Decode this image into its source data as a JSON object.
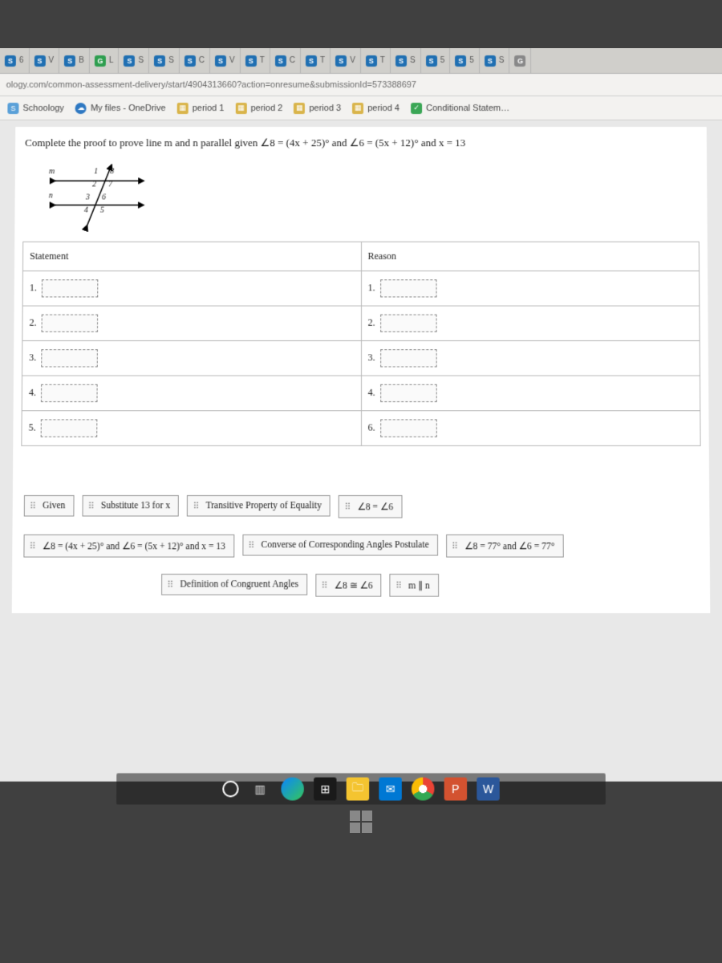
{
  "browser": {
    "tabs": [
      {
        "icon": "S",
        "label": "6"
      },
      {
        "icon": "S",
        "label": "V"
      },
      {
        "icon": "S",
        "label": "B"
      },
      {
        "icon": "G",
        "label": "L"
      },
      {
        "icon": "S",
        "label": "S"
      },
      {
        "icon": "S",
        "label": "S"
      },
      {
        "icon": "S",
        "label": "C"
      },
      {
        "icon": "S",
        "label": "V"
      },
      {
        "icon": "S",
        "label": "T"
      },
      {
        "icon": "S",
        "label": "C"
      },
      {
        "icon": "S",
        "label": "T"
      },
      {
        "icon": "S",
        "label": "V"
      },
      {
        "icon": "S",
        "label": "T"
      },
      {
        "icon": "S",
        "label": "S"
      },
      {
        "icon": "S",
        "label": "5"
      },
      {
        "icon": "S",
        "label": "5"
      },
      {
        "icon": "S",
        "label": "S"
      },
      {
        "icon": "G",
        "label": ""
      }
    ],
    "url": "ology.com/common-assessment-delivery/start/4904313660?action=onresume&submissionId=573388697",
    "bookmarks": [
      {
        "label": "Schoology",
        "kind": "schoology"
      },
      {
        "label": "My files - OneDrive",
        "kind": "cloud"
      },
      {
        "label": "period 1",
        "kind": "sheet"
      },
      {
        "label": "period 2",
        "kind": "sheet"
      },
      {
        "label": "period 3",
        "kind": "sheet"
      },
      {
        "label": "period 4",
        "kind": "sheet"
      },
      {
        "label": "Conditional Statem…",
        "kind": "check"
      }
    ]
  },
  "question": {
    "prompt": "Complete the proof to prove line m and n parallel given ∠8 = (4x + 25)° and ∠6 = (5x + 12)° and x = 13",
    "diagram": {
      "line_m": "m",
      "line_n": "n",
      "angles": [
        "1",
        "2",
        "3",
        "4",
        "5",
        "6",
        "7",
        "8"
      ]
    },
    "table": {
      "headers": {
        "statement": "Statement",
        "reason": "Reason"
      },
      "rows": [
        {
          "s": "1.",
          "r": "1."
        },
        {
          "s": "2.",
          "r": "2."
        },
        {
          "s": "3.",
          "r": "3."
        },
        {
          "s": "4.",
          "r": "4."
        },
        {
          "s": "5.",
          "r": "6."
        }
      ]
    },
    "tiles": [
      "Given",
      "Substitute 13 for x",
      "Transitive Property of Equality",
      "∠8 = ∠6",
      "∠8 = (4x + 25)° and ∠6 = (5x + 12)° and x = 13",
      "Converse of Corresponding Angles Postulate",
      "∠8 = 77° and ∠6 = 77°",
      "Definition of Congruent Angles",
      "∠8 ≅ ∠6",
      "m ∥ n"
    ]
  },
  "taskbar": {
    "items": [
      "start",
      "task-view",
      "edge",
      "store",
      "files",
      "mail",
      "chrome",
      "powerpoint",
      "word"
    ]
  }
}
